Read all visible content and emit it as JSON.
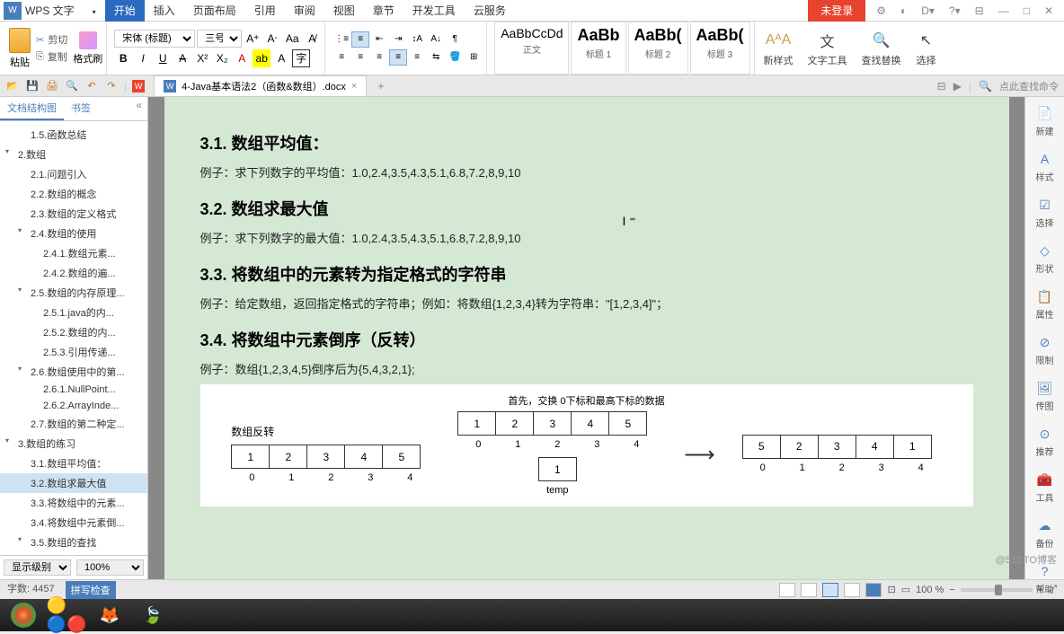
{
  "app": {
    "name": "WPS 文字",
    "login": "未登录"
  },
  "menu": {
    "tabs": [
      "开始",
      "插入",
      "页面布局",
      "引用",
      "审阅",
      "视图",
      "章节",
      "开发工具",
      "云服务"
    ],
    "active": 0
  },
  "clipboard": {
    "paste": "粘贴",
    "cut": "剪切",
    "copy": "复制",
    "format": "格式刷"
  },
  "font": {
    "name": "宋体 (标题)",
    "size": "三号"
  },
  "styles": {
    "items": [
      {
        "sample": "AaBbCcDd",
        "label": "正文"
      },
      {
        "sample": "AaBb",
        "label": "标题 1"
      },
      {
        "sample": "AaBb(",
        "label": "标题 2"
      },
      {
        "sample": "AaBb(",
        "label": "标题 3"
      }
    ],
    "newstyle": "新样式",
    "texttools": "文字工具",
    "findreplace": "查找替换",
    "select": "选择"
  },
  "qat": {
    "search_placeholder": "点此查找命令"
  },
  "doctab": {
    "name": "4-Java基本语法2（函数&数组）.docx"
  },
  "outline": {
    "tab1": "文档结构图",
    "tab2": "书签",
    "display_level": "显示级别",
    "zoom": "100%",
    "items": [
      {
        "l": 2,
        "t": "1.5.函数总结"
      },
      {
        "l": 1,
        "t": "2.数组",
        "exp": true
      },
      {
        "l": 2,
        "t": "2.1.问题引入"
      },
      {
        "l": 2,
        "t": "2.2.数组的概念"
      },
      {
        "l": 2,
        "t": "2.3.数组的定义格式"
      },
      {
        "l": 2,
        "t": "2.4.数组的使用",
        "exp": true
      },
      {
        "l": 3,
        "t": "2.4.1.数组元素..."
      },
      {
        "l": 3,
        "t": "2.4.2.数组的遍..."
      },
      {
        "l": 2,
        "t": "2.5.数组的内存原理...",
        "exp": true
      },
      {
        "l": 3,
        "t": "2.5.1.java的内..."
      },
      {
        "l": 3,
        "t": "2.5.2.数组的内..."
      },
      {
        "l": 3,
        "t": "2.5.3.引用传递..."
      },
      {
        "l": 2,
        "t": "2.6.数组使用中的第...",
        "exp": true
      },
      {
        "l": 3,
        "t": "2.6.1.NullPoint..."
      },
      {
        "l": 3,
        "t": "2.6.2.ArrayInde..."
      },
      {
        "l": 2,
        "t": "2.7.数组的第二种定..."
      },
      {
        "l": 1,
        "t": "3.数组的练习",
        "exp": true
      },
      {
        "l": 2,
        "t": "3.1.数组平均值："
      },
      {
        "l": 2,
        "t": "3.2.数组求最大值",
        "sel": true
      },
      {
        "l": 2,
        "t": "3.3.将数组中的元素..."
      },
      {
        "l": 2,
        "t": "3.4.将数组中元素倒..."
      },
      {
        "l": 2,
        "t": "3.5.数组的查找",
        "exp": true
      },
      {
        "l": 3,
        "t": "3.5.1.普通查找"
      }
    ]
  },
  "doc": {
    "h31": "3.1. 数组平均值：",
    "p31": "例子：求下列数字的平均值：1.0,2.4,3.5,4.3,5.1,6.8,7.2,8,9,10",
    "h32": "3.2. 数组求最大值",
    "p32": "例子：求下列数字的最大值：1.0,2.4,3.5,4.3,5.1,6.8,7.2,8,9,10",
    "h33": "3.3. 将数组中的元素转为指定格式的字符串",
    "p33": "例子：给定数组，返回指定格式的字符串；例如：将数组{1,2,3,4}转为字符串：\"[1,2,3,4]\"；",
    "h34": "3.4. 将数组中元素倒序（反转）",
    "p34": "例子：数组{1,2,3,4,5}倒序后为{5,4,3,2,1};",
    "dia_note": "首先，交换 0下标和最高下标的数据",
    "dia_label": "数组反转",
    "arr1": [
      "1",
      "2",
      "3",
      "4",
      "5"
    ],
    "idx1": [
      "0",
      "1",
      "2",
      "3",
      "4"
    ],
    "arr2": [
      "1",
      "2",
      "3",
      "4",
      "5"
    ],
    "idx2": [
      "0",
      "1",
      "2",
      "3",
      "4"
    ],
    "arr2b": [
      "1"
    ],
    "idx2b": [
      "temp"
    ],
    "arr3": [
      "5",
      "2",
      "3",
      "4",
      "1"
    ],
    "idx3": [
      "0",
      "1",
      "2",
      "3",
      "4"
    ]
  },
  "rightpanel": {
    "items": [
      {
        "icon": "📄",
        "label": "新建"
      },
      {
        "icon": "A",
        "label": "样式"
      },
      {
        "icon": "☑",
        "label": "选择"
      },
      {
        "icon": "◇",
        "label": "形状"
      },
      {
        "icon": "📋",
        "label": "属性"
      },
      {
        "icon": "⊘",
        "label": "限制"
      },
      {
        "icon": "🖼",
        "label": "传图"
      },
      {
        "icon": "⊙",
        "label": "推荐"
      },
      {
        "icon": "🧰",
        "label": "工具"
      },
      {
        "icon": "☁",
        "label": "备份"
      },
      {
        "icon": "?",
        "label": "帮助"
      }
    ]
  },
  "status": {
    "words_label": "字数:",
    "words": "4457",
    "spell": "拼写检查",
    "zoom": "100 %"
  },
  "watermark": "@51CTO博客"
}
